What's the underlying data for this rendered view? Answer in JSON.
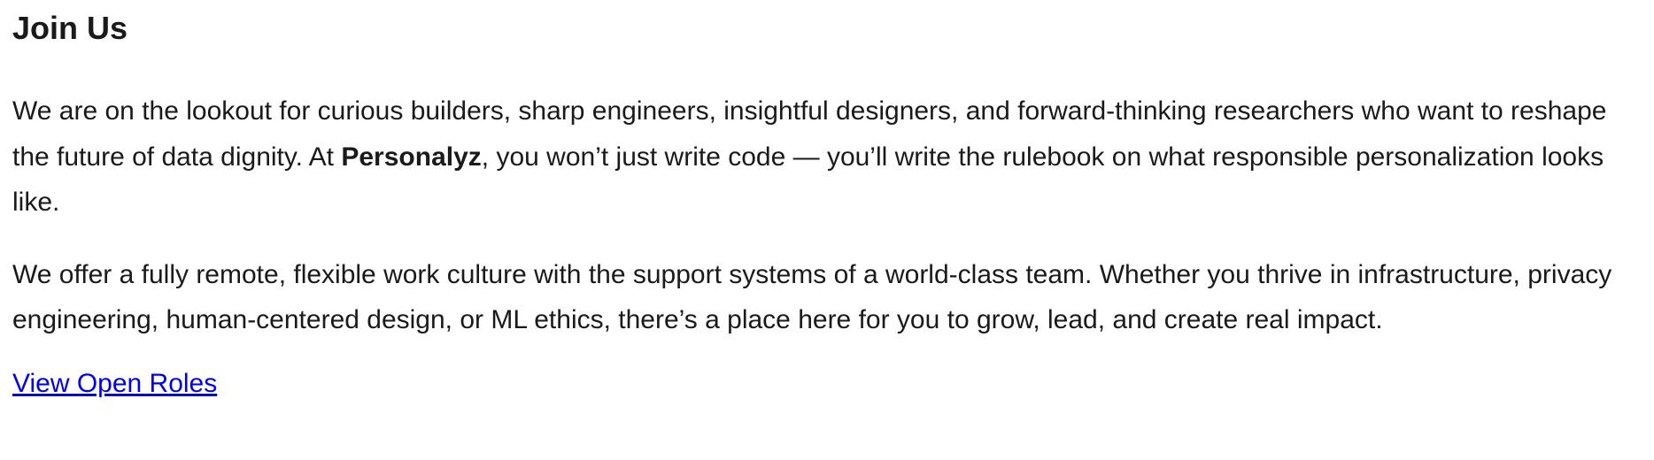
{
  "join": {
    "heading": "Join Us",
    "para1": {
      "before": "We are on the lookout for curious builders, sharp engineers, insightful designers, and forward-thinking researchers who want to reshape the future of data dignity. At ",
      "brand": "Personalyz",
      "after": ", you won’t just write code — you’ll write the rulebook on what responsible personalization looks like."
    },
    "para2": "We offer a fully remote, flexible work culture with the support systems of a world-class team. Whether you thrive in infrastructure, privacy engineering, human-centered design, or ML ethics, there’s a place here for you to grow, lead, and create real impact.",
    "cta_label": "View Open Roles",
    "colors": {
      "text": "#1a1a1a",
      "link": "#0000ee"
    }
  }
}
